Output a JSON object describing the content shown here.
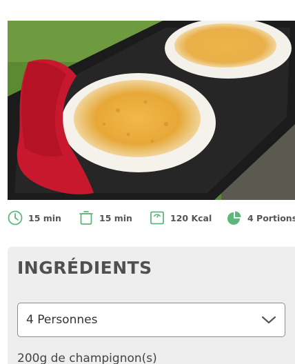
{
  "colors": {
    "accent": "#5cb87a",
    "panel_bg": "#eeeeee",
    "text": "#505050"
  },
  "stats": [
    {
      "icon": "clock-icon",
      "text": "15 min"
    },
    {
      "icon": "pot-icon",
      "text": "15 min"
    },
    {
      "icon": "scale-icon",
      "text": "120 Kcal"
    },
    {
      "icon": "pie-chart-icon",
      "text": "4 Portions"
    }
  ],
  "ingredients": {
    "title": "INGRÉDIENTS",
    "servings_select": {
      "value": "4 Personnes"
    },
    "items": [
      "200g de champignon(s)"
    ]
  }
}
